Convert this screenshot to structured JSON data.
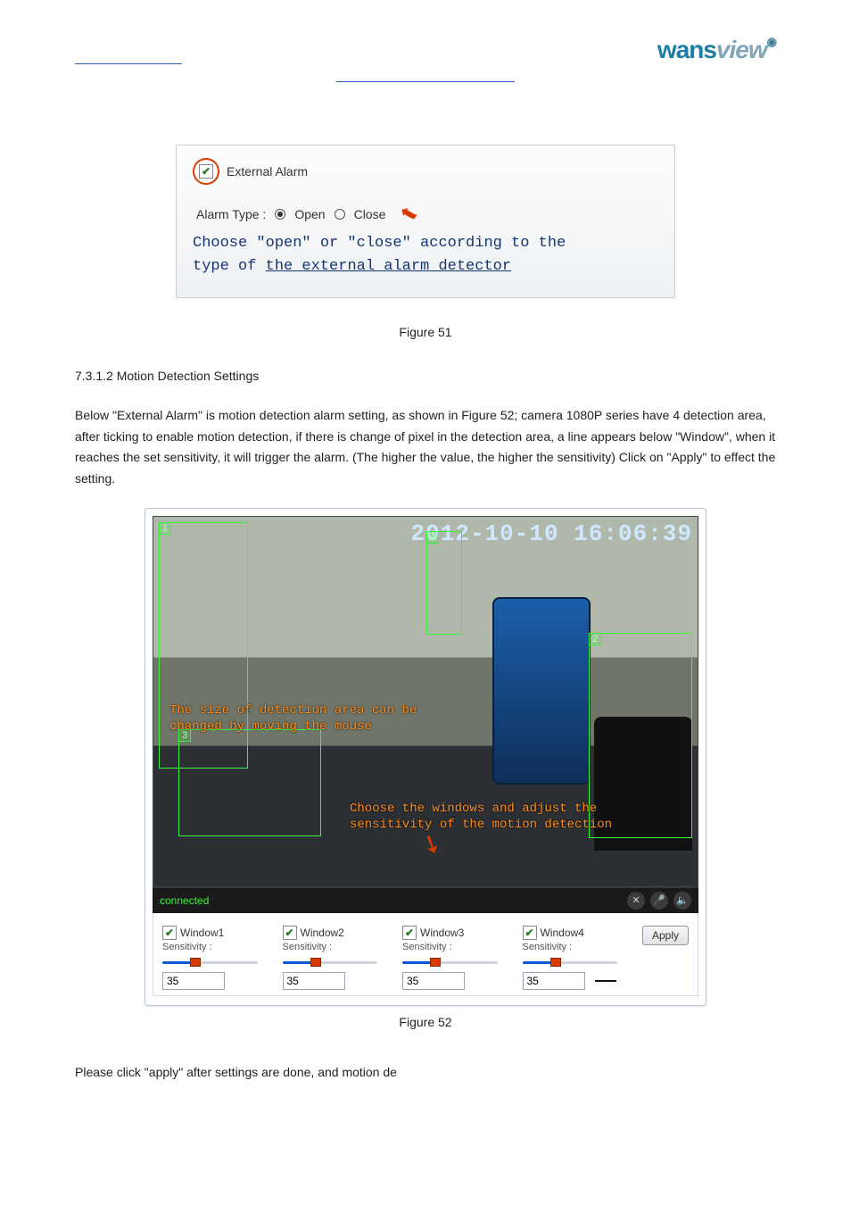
{
  "logo": {
    "part1": "wans",
    "part2": "view"
  },
  "fig51": {
    "external_alarm_label": "External Alarm",
    "alarm_type_label": "Alarm Type :",
    "open_label": "Open",
    "close_label": "Close",
    "instruction_line1": "Choose \"open\" or \"close\" according to the",
    "instruction_line2_prefix": "type of ",
    "instruction_line2_underlined": "the external alarm detector"
  },
  "caption51": "Figure 51",
  "section_heading": "7.3.1.2 Motion Detection Settings",
  "para": "Below \"External Alarm\" is motion detection alarm setting, as shown in Figure 52; camera 1080P series have 4 detection area, after ticking to enable motion detection, if there is change of pixel in the detection area, a line appears below \"Window\", when it reaches the set sensitivity, it will trigger the alarm. (The higher the value, the higher the sensitivity) Click on \"Apply\" to effect the setting.",
  "camera": {
    "timestamp": "2012-10-10 16:06:39",
    "status": "connected",
    "box_labels": {
      "b1": "1",
      "b2": "2",
      "b3": "3",
      "b4": "4"
    },
    "anno1_l1": "The size of detection area can be",
    "anno1_l2": "changed by moving the mouse",
    "anno2_l1": "Choose the windows and adjust the",
    "anno2_l2": "sensitivity of the motion detection",
    "icons": {
      "a": "✕",
      "b": "🎤",
      "c": "🔈"
    }
  },
  "controls": {
    "windows": [
      {
        "name": "Window1",
        "sens_label": "Sensitivity :",
        "value": "35"
      },
      {
        "name": "Window2",
        "sens_label": "Sensitivity :",
        "value": "35"
      },
      {
        "name": "Window3",
        "sens_label": "Sensitivity :",
        "value": "35"
      },
      {
        "name": "Window4",
        "sens_label": "Sensitivity :",
        "value": "35"
      }
    ],
    "apply": "Apply"
  },
  "caption52": "Figure 52",
  "after": "Please click \"apply\" after settings are done, and motion de"
}
